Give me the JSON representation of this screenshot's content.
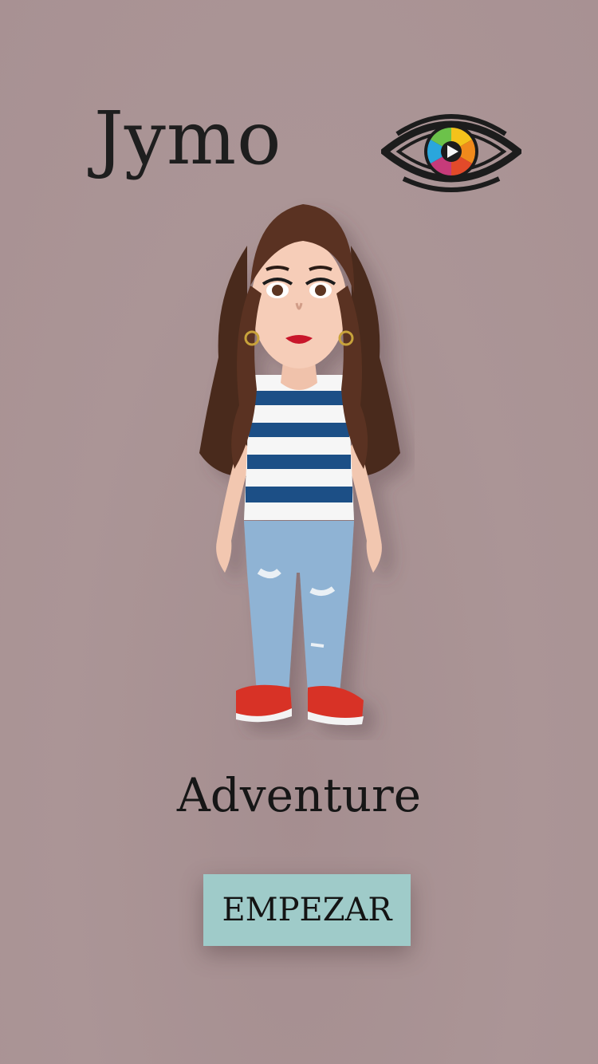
{
  "brand": {
    "name": "Jymo",
    "logo_icon": "eye-play-icon"
  },
  "hero": {
    "avatar": "avatar-girl-striped-shirt"
  },
  "tagline": "Adventure",
  "actions": {
    "start_label": "EMPEZAR"
  },
  "colors": {
    "background": "#a99394",
    "button": "#9fcbc9",
    "text": "#161616"
  }
}
